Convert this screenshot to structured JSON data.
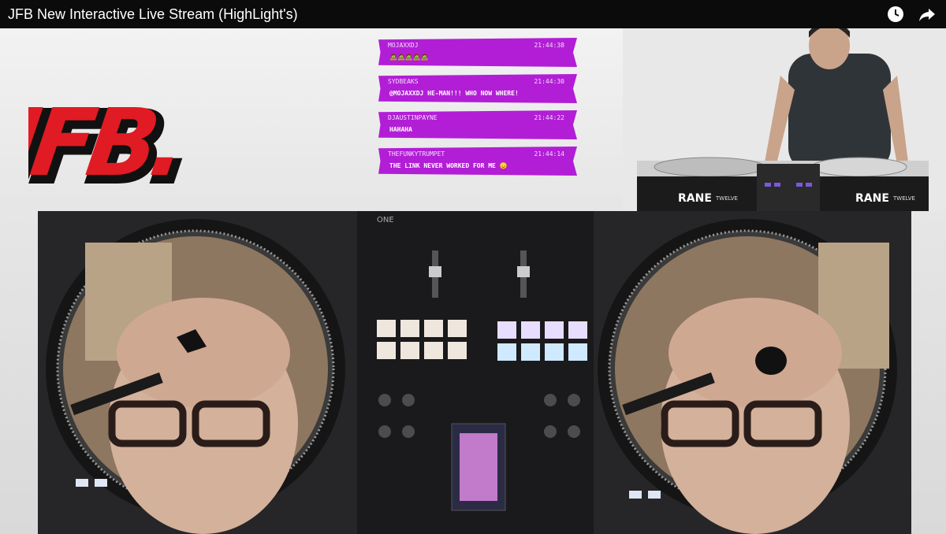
{
  "window": {
    "title": "JFB New Interactive Live Stream (HighLight's)"
  },
  "overlay": {
    "logo_text": "JFB.",
    "brand_color": "#e01b23",
    "chat_color": "#b21ed6"
  },
  "chat": [
    {
      "user": "mojaxxdj",
      "time": "21:44:38",
      "text": "🧟🧟🧟🧟🧟"
    },
    {
      "user": "sydbeaks",
      "time": "21:44:30",
      "text": "@mojaxxdj HE-MAN!!! who now where!"
    },
    {
      "user": "djaustinpayne",
      "time": "21:44:22",
      "text": "hahaha"
    },
    {
      "user": "thefunkytrumpet",
      "time": "21:44:14",
      "text": "the link never worked for me 😞"
    }
  ],
  "hardware": {
    "mixer_brand": "RANE",
    "deck_label": "TWELVE",
    "controller_model": "ONE"
  },
  "icons": {
    "watch_later": "clock-icon",
    "share": "share-arrow-icon"
  }
}
